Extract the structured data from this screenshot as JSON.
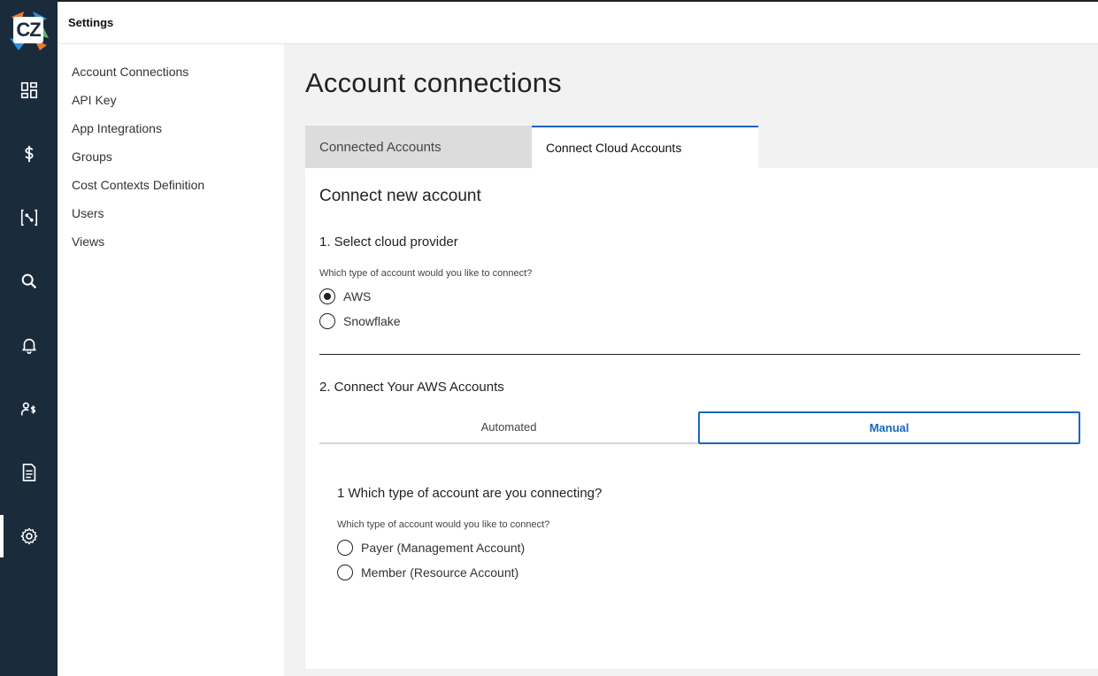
{
  "app": {
    "logo_text": "CZ",
    "header_title": "Settings"
  },
  "rail": {
    "items": [
      {
        "name": "dashboard-icon"
      },
      {
        "name": "dollar-icon"
      },
      {
        "name": "insights-icon"
      },
      {
        "name": "search-icon"
      },
      {
        "name": "bell-icon"
      },
      {
        "name": "cost-people-icon"
      },
      {
        "name": "document-icon"
      },
      {
        "name": "gear-icon",
        "active": true
      }
    ]
  },
  "settings_nav": {
    "items": [
      "Account Connections",
      "API Key",
      "App Integrations",
      "Groups",
      "Cost Contexts Definition",
      "Users",
      "Views"
    ]
  },
  "main": {
    "title": "Account connections",
    "tabs": [
      {
        "label": "Connected Accounts",
        "active": false
      },
      {
        "label": "Connect Cloud Accounts",
        "active": true
      }
    ],
    "connect_title": "Connect new account",
    "step1": {
      "title": "1. Select cloud provider",
      "hint": "Which type of account would you like to connect?",
      "options": [
        {
          "label": "AWS",
          "checked": true
        },
        {
          "label": "Snowflake",
          "checked": false
        }
      ]
    },
    "step2": {
      "title": "2. Connect Your AWS Accounts",
      "subtabs": [
        {
          "label": "Automated",
          "active": false
        },
        {
          "label": "Manual",
          "active": true
        }
      ],
      "question": "1 Which type of account are you connecting?",
      "hint": "Which type of account would you like to connect?",
      "options": [
        {
          "label": "Payer (Management Account)",
          "checked": false
        },
        {
          "label": "Member (Resource Account)",
          "checked": false
        }
      ]
    }
  },
  "colors": {
    "rail_bg": "#1a2b3c",
    "accent": "#1565c0",
    "tab_inactive_bg": "#dcdcdc"
  }
}
